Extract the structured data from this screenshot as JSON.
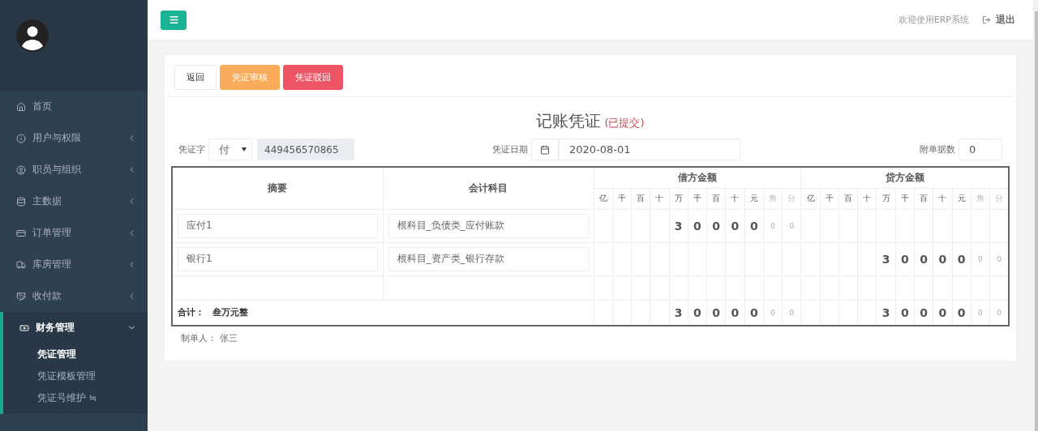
{
  "header": {
    "welcome": "欢迎使用ERP系统",
    "logout": "退出"
  },
  "sidebar": {
    "items": [
      {
        "label": "首页",
        "kind": "link",
        "expanded": false
      },
      {
        "label": "用户与权限",
        "kind": "menu",
        "expanded": false
      },
      {
        "label": "职员与组织",
        "kind": "menu",
        "expanded": false
      },
      {
        "label": "主数据",
        "kind": "menu",
        "expanded": false
      },
      {
        "label": "订单管理",
        "kind": "menu",
        "expanded": false
      },
      {
        "label": "库房管理",
        "kind": "menu",
        "expanded": false
      },
      {
        "label": "收付款",
        "kind": "menu",
        "expanded": false
      },
      {
        "label": "财务管理",
        "kind": "menu",
        "expanded": true,
        "children": [
          {
            "label": "凭证管理",
            "selected": true
          },
          {
            "label": "凭证模板管理",
            "selected": false
          },
          {
            "label": "凭证号维护 ≒",
            "selected": false
          }
        ]
      }
    ]
  },
  "toolbar": [
    {
      "label": "返回",
      "kind": "default"
    },
    {
      "label": "凭证审核",
      "kind": "warning"
    },
    {
      "label": "凭证驳回",
      "kind": "danger"
    }
  ],
  "title": "记账凭证",
  "status": "(已提交)",
  "fields": {
    "word_label": "凭证字",
    "word_value": "付",
    "number": "449456570865",
    "date_label": "凭证日期",
    "date": "2020-08-01",
    "attachments_label": "附单据数",
    "attachments": "0"
  },
  "table": {
    "summary_header": "摘要",
    "account_header": "会计科目",
    "debit_header": "借方金额",
    "credit_header": "贷方金额",
    "debit_digit_headers": [
      "亿",
      "千",
      "百",
      "十",
      "万",
      "千",
      "百",
      "十",
      "元",
      "角",
      "分"
    ],
    "credit_digit_headers": [
      "亿",
      "千",
      "百",
      "十",
      "万",
      "千",
      "百",
      "十",
      "元",
      "角",
      "分"
    ],
    "rows": [
      {
        "summary": "应付1",
        "account": "根科目_负债类_应付账款",
        "debit": [
          "3",
          "0",
          "0",
          "0",
          "0",
          "0",
          "0"
        ]
      },
      {
        "summary": "银行1",
        "account": "根科目_资产类_银行存款",
        "credit": [
          "3",
          "0",
          "0",
          "0",
          "0",
          "0",
          "0"
        ]
      },
      {}
    ],
    "total": {
      "label": "合计：",
      "words": "叁万元整",
      "debit": [
        "3",
        "0",
        "0",
        "0",
        "0",
        "0",
        "0"
      ],
      "credit": [
        "3",
        "0",
        "0",
        "0",
        "0",
        "0",
        "0"
      ]
    }
  },
  "footer": {
    "label": "制单人：",
    "name": "张三"
  }
}
